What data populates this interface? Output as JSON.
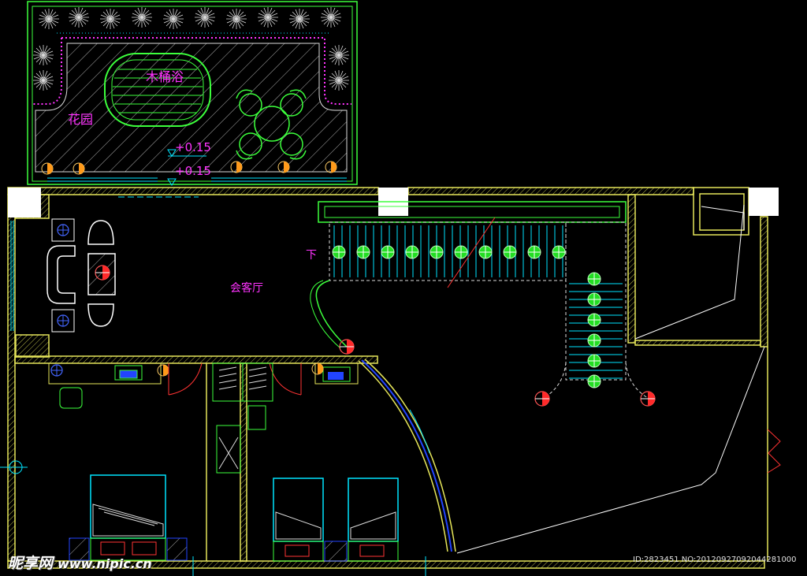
{
  "labels": {
    "tub": "木桶浴",
    "garden": "花园",
    "level_1": "+0.15",
    "level_2": "+0.15",
    "stair_down": "下",
    "living_room": "会客厅"
  },
  "watermark": {
    "brand": "昵享网",
    "url": "www.nipic.cn"
  },
  "image_id": "ID:2823451 NO:20120927092044281000",
  "colors": {
    "wall": "#e6e65a",
    "cyan": "#00e5ff",
    "green": "#3cff3c",
    "magenta": "#ff33ff",
    "white": "#ffffff",
    "red": "#ff2a2a",
    "blue": "#2244ff",
    "orange": "#ff9a1a"
  }
}
